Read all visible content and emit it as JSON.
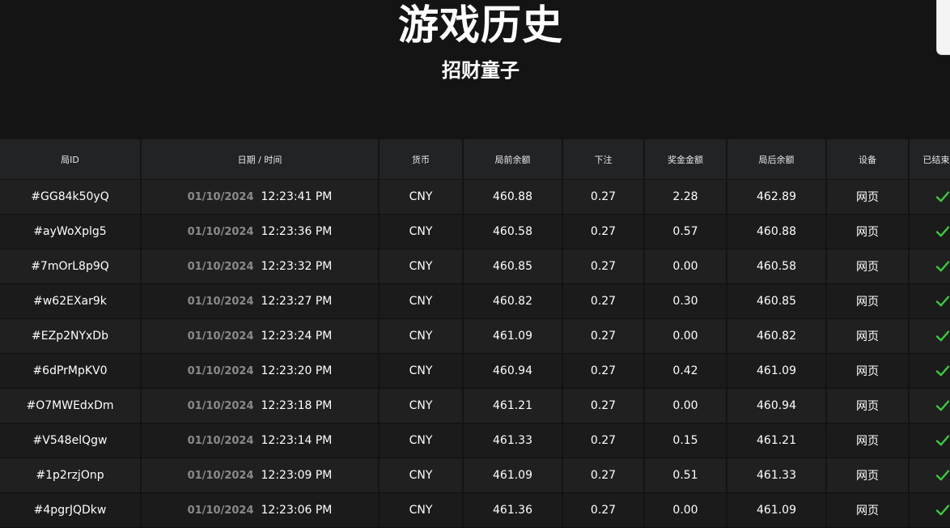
{
  "page": {
    "title": "游戏历史",
    "subtitle": "招财童子"
  },
  "colors": {
    "background": "#141414",
    "header_bg": "#222325",
    "row_bg_a": "#202021",
    "row_bg_b": "#1b1b1b",
    "date_text": "#8a8a8a",
    "check": "#3cc83c"
  },
  "table": {
    "headers": [
      "局ID",
      "日期 / 时间",
      "货币",
      "局前余额",
      "下注",
      "奖金金额",
      "局后余额",
      "设备",
      "已结束"
    ],
    "rows": [
      {
        "id": "#GG84k50yQ",
        "date": "01/10/2024",
        "time": "12:23:41 PM",
        "currency": "CNY",
        "balance_before": "460.88",
        "bet": "0.27",
        "win": "2.28",
        "balance_after": "462.89",
        "device": "网页",
        "finished_icon": "check-icon"
      },
      {
        "id": "#ayWoXplg5",
        "date": "01/10/2024",
        "time": "12:23:36 PM",
        "currency": "CNY",
        "balance_before": "460.58",
        "bet": "0.27",
        "win": "0.57",
        "balance_after": "460.88",
        "device": "网页",
        "finished_icon": "check-icon"
      },
      {
        "id": "#7mOrL8p9Q",
        "date": "01/10/2024",
        "time": "12:23:32 PM",
        "currency": "CNY",
        "balance_before": "460.85",
        "bet": "0.27",
        "win": "0.00",
        "balance_after": "460.58",
        "device": "网页",
        "finished_icon": "check-icon"
      },
      {
        "id": "#w62EXar9k",
        "date": "01/10/2024",
        "time": "12:23:27 PM",
        "currency": "CNY",
        "balance_before": "460.82",
        "bet": "0.27",
        "win": "0.30",
        "balance_after": "460.85",
        "device": "网页",
        "finished_icon": "check-icon"
      },
      {
        "id": "#EZp2NYxDb",
        "date": "01/10/2024",
        "time": "12:23:24 PM",
        "currency": "CNY",
        "balance_before": "461.09",
        "bet": "0.27",
        "win": "0.00",
        "balance_after": "460.82",
        "device": "网页",
        "finished_icon": "check-icon"
      },
      {
        "id": "#6dPrMpKV0",
        "date": "01/10/2024",
        "time": "12:23:20 PM",
        "currency": "CNY",
        "balance_before": "460.94",
        "bet": "0.27",
        "win": "0.42",
        "balance_after": "461.09",
        "device": "网页",
        "finished_icon": "check-icon"
      },
      {
        "id": "#O7MWEdxDm",
        "date": "01/10/2024",
        "time": "12:23:18 PM",
        "currency": "CNY",
        "balance_before": "461.21",
        "bet": "0.27",
        "win": "0.00",
        "balance_after": "460.94",
        "device": "网页",
        "finished_icon": "check-icon"
      },
      {
        "id": "#V548elQgw",
        "date": "01/10/2024",
        "time": "12:23:14 PM",
        "currency": "CNY",
        "balance_before": "461.33",
        "bet": "0.27",
        "win": "0.15",
        "balance_after": "461.21",
        "device": "网页",
        "finished_icon": "check-icon"
      },
      {
        "id": "#1p2rzjOnp",
        "date": "01/10/2024",
        "time": "12:23:09 PM",
        "currency": "CNY",
        "balance_before": "461.09",
        "bet": "0.27",
        "win": "0.51",
        "balance_after": "461.33",
        "device": "网页",
        "finished_icon": "check-icon"
      },
      {
        "id": "#4pgrJQDkw",
        "date": "01/10/2024",
        "time": "12:23:06 PM",
        "currency": "CNY",
        "balance_before": "461.36",
        "bet": "0.27",
        "win": "0.00",
        "balance_after": "461.09",
        "device": "网页",
        "finished_icon": "check-icon"
      }
    ]
  }
}
